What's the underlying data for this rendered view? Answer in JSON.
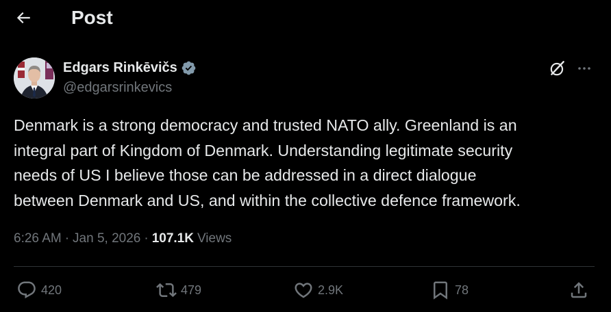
{
  "header": {
    "title": "Post",
    "back_icon": "arrow-left-icon"
  },
  "author": {
    "name": "Edgars Rinkēvičs",
    "handle": "@edgarsrinkevics",
    "verified_icon": "verified-badge-icon",
    "verified_color": "#829aab"
  },
  "actions_top": {
    "grok_icon": "grok-icon",
    "more_icon": "more-horizontal-icon"
  },
  "post": {
    "text": "Denmark is a strong democracy and trusted NATO ally. Greenland is an\nintegral part of Kingdom of Denmark. Understanding legitimate security\nneeds of US I believe those can be addressed in a direct dialogue\nbetween Denmark and US, and within the collective defence framework.",
    "time": "6:26 AM",
    "separator": "·",
    "date": "Jan 5, 2026",
    "views_count": "107.1K",
    "views_label": "Views"
  },
  "engagement": {
    "replies": "420",
    "reposts": "479",
    "likes": "2.9K",
    "bookmarks": "78"
  },
  "colors": {
    "background": "#000000",
    "text_primary": "#e7e9ea",
    "text_secondary": "#71767b",
    "divider": "#2f3336"
  }
}
